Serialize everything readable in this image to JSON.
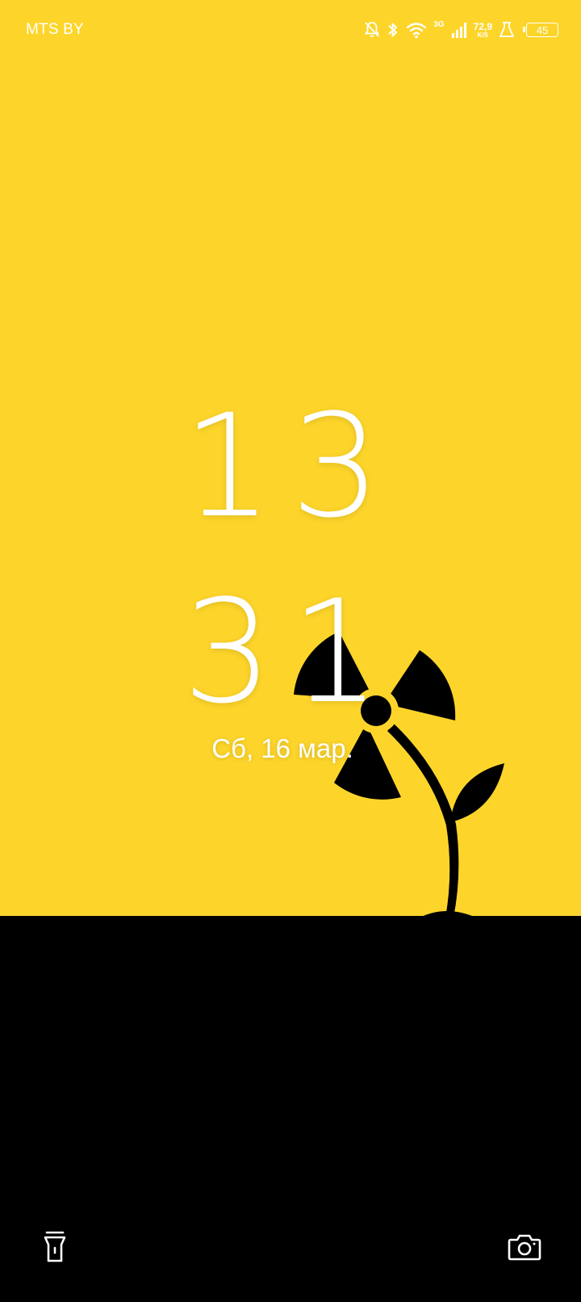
{
  "status_bar": {
    "carrier": "MTS BY",
    "network_type": "3G",
    "speed_value": "72,9",
    "speed_unit": "K/S",
    "battery_level": "45",
    "icons": [
      "bell-off-icon",
      "bluetooth-icon",
      "wifi-icon",
      "signal-icon",
      "lab-flask-icon",
      "battery-icon"
    ]
  },
  "lockscreen": {
    "hour": "13",
    "minute": "31",
    "date": "Сб, 16 мар."
  },
  "shortcuts": {
    "left": "flashlight-icon",
    "right": "camera-icon"
  },
  "colors": {
    "sky": "#FDD52A",
    "ground": "#000000",
    "text": "#FFFFFF"
  }
}
